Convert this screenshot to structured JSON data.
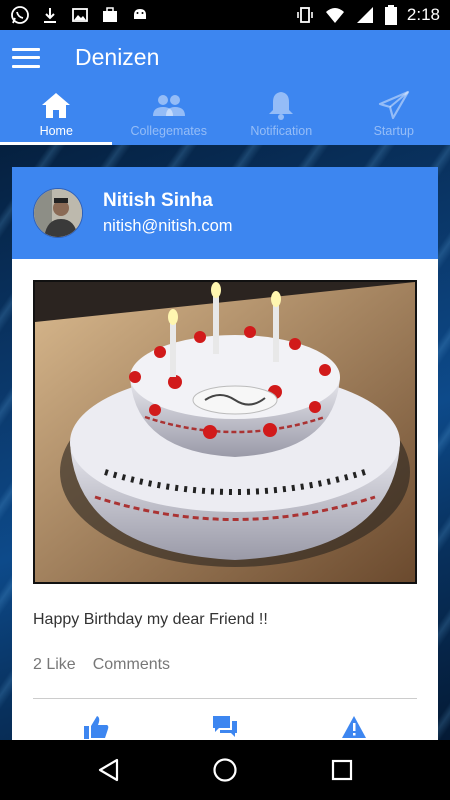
{
  "status_bar": {
    "time": "2:18",
    "icons": [
      "whatsapp-icon",
      "download-icon",
      "image-icon",
      "briefcase-icon",
      "android-icon",
      "vibrate-icon",
      "wifi-icon",
      "signal-icon",
      "battery-icon"
    ]
  },
  "app_bar": {
    "title": "Denizen",
    "color": "#3d86f0"
  },
  "tabs": [
    {
      "label": "Home",
      "icon": "home-icon",
      "active": true
    },
    {
      "label": "Collegemates",
      "icon": "people-icon",
      "active": false
    },
    {
      "label": "Notification",
      "icon": "bell-icon",
      "active": false
    },
    {
      "label": "Startup",
      "icon": "send-icon",
      "active": false
    }
  ],
  "post": {
    "author_name": "Nitish Sinha",
    "author_email": "nitish@nitish.com",
    "image_description": "birthday-cake-photo",
    "text": "Happy Birthday my dear Friend !!",
    "likes_label": "2 Like",
    "comments_label": "Comments",
    "actions": [
      "like-icon",
      "comment-icon",
      "report-icon"
    ]
  },
  "nav_bar": {
    "buttons": [
      "back-icon",
      "home-icon",
      "recents-icon"
    ]
  }
}
